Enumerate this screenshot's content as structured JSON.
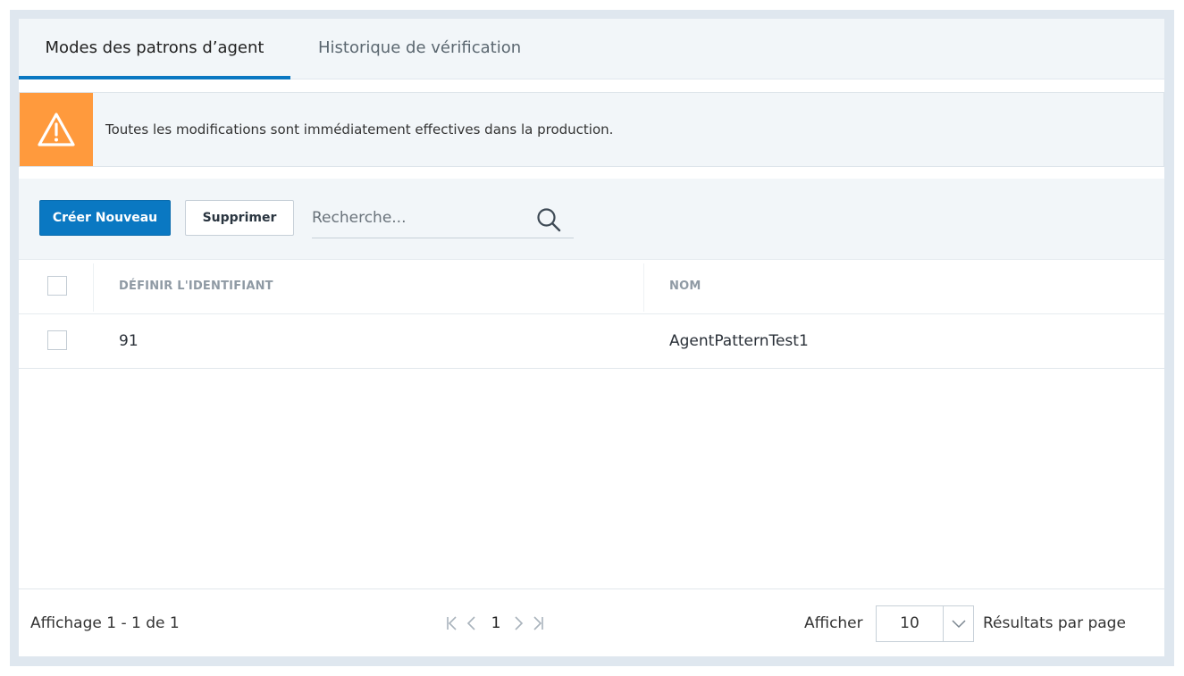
{
  "tabs": [
    {
      "label": "Modes des patrons d’agent",
      "active": true
    },
    {
      "label": "Historique de vérification",
      "active": false
    }
  ],
  "warning": {
    "text": "Toutes les modifications sont immédiatement effectives dans la production.",
    "icon": "warning-triangle-icon",
    "color": "#ff9a3d"
  },
  "toolbar": {
    "create_label": "Créer Nouveau",
    "delete_label": "Supprimer",
    "search_placeholder": "Recherche...",
    "search_value": ""
  },
  "table": {
    "columns": [
      "DÉFINIR L'IDENTIFIANT",
      "NOM"
    ],
    "rows": [
      {
        "id": "91",
        "name": "AgentPatternTest1"
      }
    ]
  },
  "footer": {
    "showing": "Affichage 1 - 1 de 1",
    "current_page": "1",
    "show_label": "Afficher",
    "page_size": "10",
    "per_page_label": "Résultats par page"
  },
  "colors": {
    "accent": "#0a78c2",
    "warning": "#ff9a3d",
    "frame": "#dfe7ef"
  }
}
